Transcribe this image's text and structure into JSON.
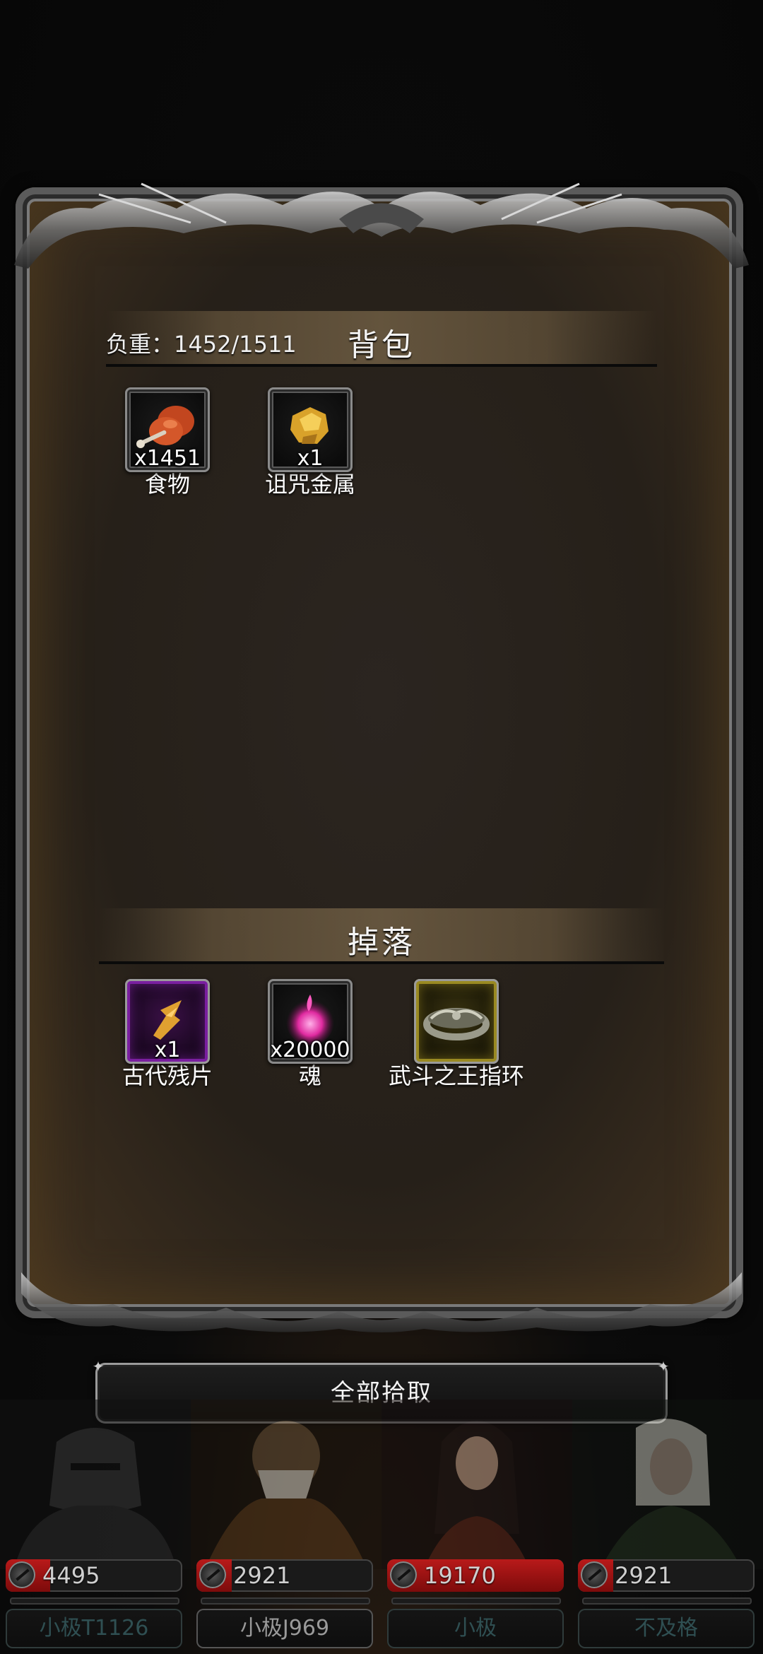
{
  "backpack": {
    "title": "背包",
    "weight_label": "负重：1452/1511",
    "items": [
      {
        "name": "食物",
        "qty": "x1451",
        "icon": "drumstick-icon"
      },
      {
        "name": "诅咒金属",
        "qty": "x1",
        "icon": "gold-ore-icon"
      }
    ]
  },
  "drops": {
    "title": "掉落",
    "items": [
      {
        "name": "古代残片",
        "qty": "x1",
        "icon": "fragment-icon",
        "rarity": "purple"
      },
      {
        "name": "魂",
        "qty": "x20000",
        "icon": "soul-orb-icon",
        "rarity": "normal"
      },
      {
        "name": "武斗之王指环",
        "qty": "",
        "icon": "ring-icon",
        "rarity": "gold"
      }
    ]
  },
  "actions": {
    "collect_all": "全部拾取"
  },
  "heroes": [
    {
      "name": "小极T1126",
      "hp": "4495",
      "hp_fraction": 0.25
    },
    {
      "name": "小极J969",
      "hp": "2921",
      "hp_fraction": 0.2
    },
    {
      "name": "小极",
      "hp": "19170",
      "hp_fraction": 1.0
    },
    {
      "name": "不及格",
      "hp": "2921",
      "hp_fraction": 0.2
    }
  ],
  "colors": {
    "rarity_purple": "#7a1fa0",
    "rarity_gold": "#9a8a22",
    "hp_red": "#b81a1a"
  }
}
